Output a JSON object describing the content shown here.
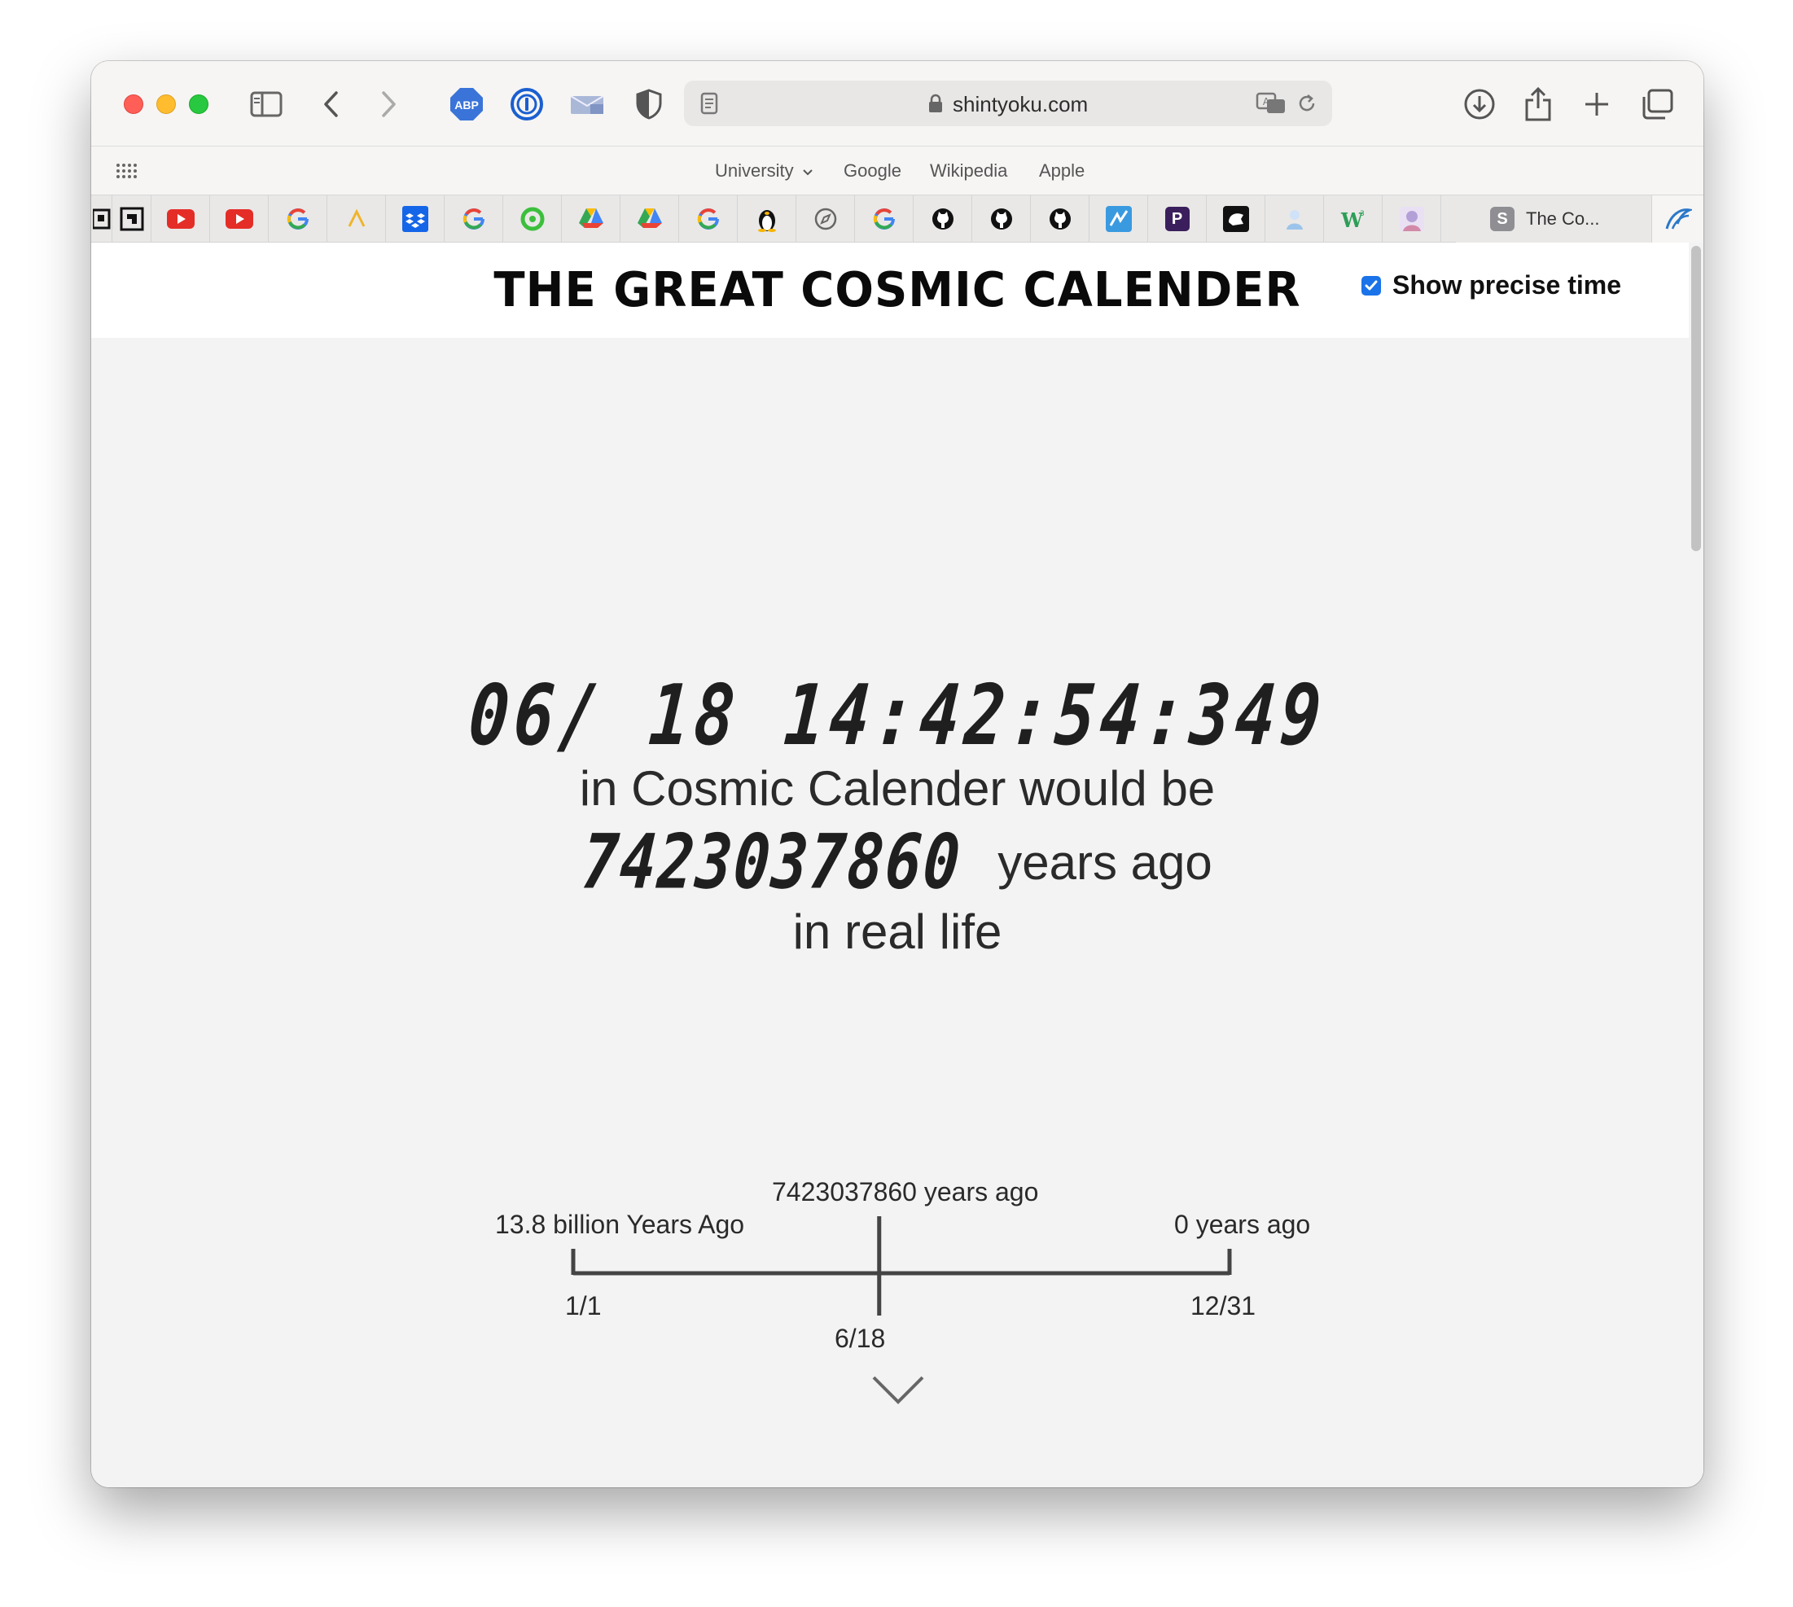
{
  "browser": {
    "url": "shintyoku.com",
    "favorites": [
      "University",
      "Google",
      "Wikipedia",
      "Apple"
    ],
    "active_tab_badge": "S",
    "active_tab_title": "The Co...",
    "extensions": {
      "abp": "ABP"
    }
  },
  "page": {
    "title": "THE GREAT COSMIC CALENDER",
    "show_precise_label": "Show precise time",
    "show_precise_checked": true,
    "cosmic_time": "06/ 18  14:42:54:349",
    "line1": "in Cosmic Calender would be",
    "years_value": "7423037860",
    "years_suffix": "years ago",
    "line3": "in real life"
  },
  "timeline": {
    "start_top": "13.8 billion Years Ago",
    "start_bottom": "1/1",
    "current_top": "7423037860 years ago",
    "current_bottom": "6/18",
    "end_top": "0 years ago",
    "end_bottom": "12/31",
    "current_fraction": 0.4662
  }
}
